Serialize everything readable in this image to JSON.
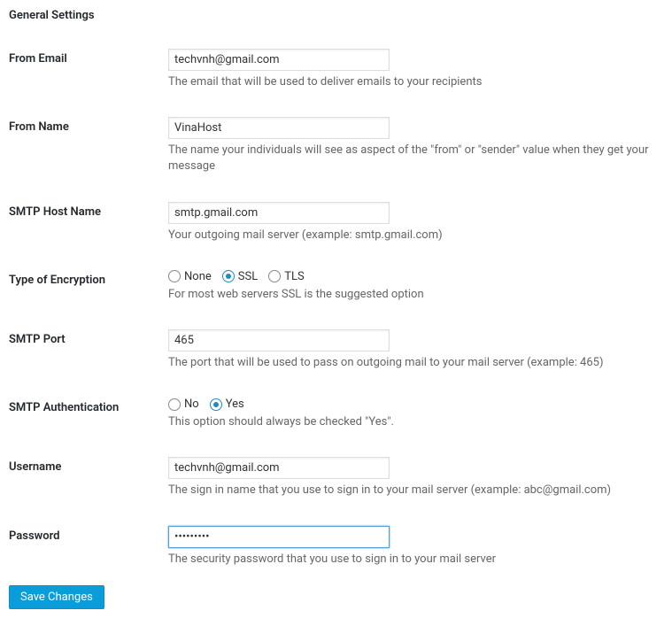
{
  "title": "General Settings",
  "fields": {
    "from_email": {
      "label": "From Email",
      "value": "techvnh@gmail.com",
      "desc": "The email that will be used to deliver emails to your recipients"
    },
    "from_name": {
      "label": "From Name",
      "value": "VinaHost",
      "desc": "The name your individuals will see as aspect of the \"from\" or \"sender\" value when they get your message"
    },
    "smtp_host": {
      "label": "SMTP Host Name",
      "value": "smtp.gmail.com",
      "desc": "Your outgoing mail server (example: smtp.gmail.com)"
    },
    "encryption": {
      "label": "Type of Encryption",
      "desc": "For most web servers SSL is the suggested option",
      "options": {
        "none": "None",
        "ssl": "SSL",
        "tls": "TLS"
      },
      "selected": "ssl"
    },
    "smtp_port": {
      "label": "SMTP Port",
      "value": "465",
      "desc": "The port that will be used to pass on outgoing mail to your mail server (example: 465)"
    },
    "smtp_auth": {
      "label": "SMTP Authentication",
      "desc": "This option should always be checked \"Yes\".",
      "options": {
        "no": "No",
        "yes": "Yes"
      },
      "selected": "yes"
    },
    "username": {
      "label": "Username",
      "value": "techvnh@gmail.com",
      "desc": "The sign in name that you use to sign in to your mail server (example: abc@gmail.com)"
    },
    "password": {
      "label": "Password",
      "value": "•••••••••",
      "desc": "The security password that you use to sign in to your mail server"
    }
  },
  "save_button": "Save Changes"
}
